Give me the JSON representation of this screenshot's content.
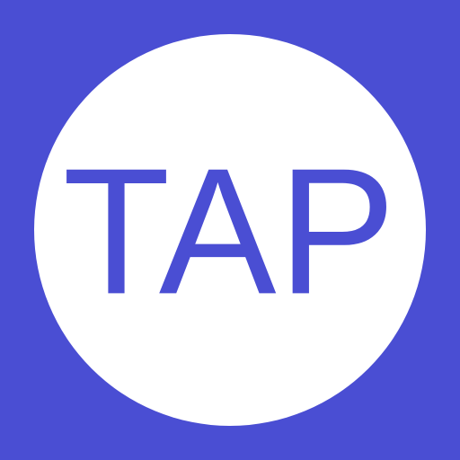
{
  "app_icon": {
    "label": "TAP",
    "background_color": "#4a4ed3",
    "circle_color": "#ffffff",
    "text_color": "#4a4ed3"
  }
}
